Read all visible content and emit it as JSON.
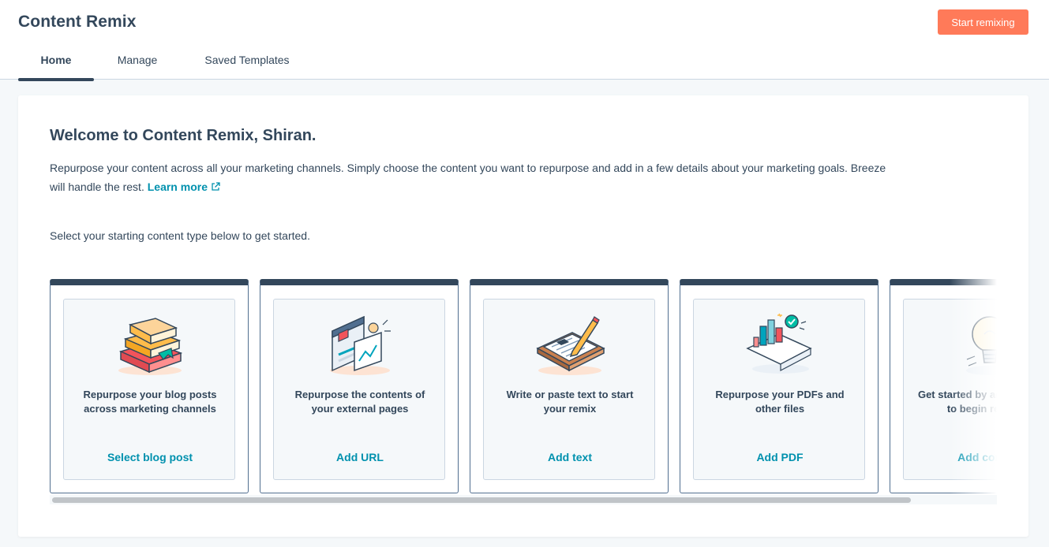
{
  "header": {
    "title": "Content Remix",
    "primary_button": "Start remixing",
    "accent_color": "#ff7a59"
  },
  "tabs": [
    {
      "label": "Home",
      "active": true
    },
    {
      "label": "Manage",
      "active": false
    },
    {
      "label": "Saved Templates",
      "active": false
    }
  ],
  "main": {
    "welcome": "Welcome to Content Remix, Shiran.",
    "description": "Repurpose your content across all your marketing channels. Simply choose the content you want to repurpose and add in a few details about your marketing goals. Breeze will handle the rest.",
    "learn_more": "Learn more",
    "select_prompt": "Select your starting content type below to get started."
  },
  "cards": [
    {
      "icon": "books-icon",
      "description": "Repurpose your blog posts across marketing channels",
      "action": "Select blog post"
    },
    {
      "icon": "web-pages-icon",
      "description": "Repurpose the contents of your external pages",
      "action": "Add URL"
    },
    {
      "icon": "clipboard-pencil-icon",
      "description": "Write or paste text to start your remix",
      "action": "Add text"
    },
    {
      "icon": "pdf-chart-icon",
      "description": "Repurpose your PDFs and other files",
      "action": "Add PDF"
    },
    {
      "icon": "lightbulb-icon",
      "description": "Get started by adding an idea to begin remixing",
      "action": "Add content"
    }
  ],
  "colors": {
    "link": "#0091ae",
    "text": "#33475b",
    "card_top": "#33475b"
  }
}
